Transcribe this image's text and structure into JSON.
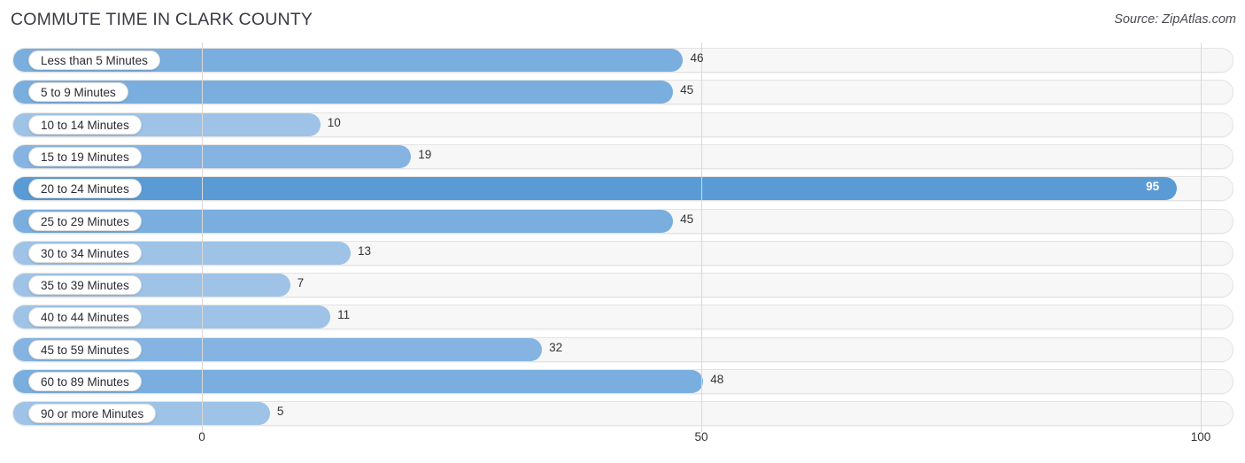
{
  "header": {
    "title": "COMMUTE TIME IN CLARK COUNTY",
    "source": "Source: ZipAtlas.com"
  },
  "colors": {
    "bar_low": "#9ec3e6",
    "bar_mid": "#85b4e2",
    "bar_high": "#7aaedf",
    "bar_max": "#5b9bd5",
    "track": "#f7f7f7",
    "gridline": "#d9d9d9",
    "title_text": "#3a3a44"
  },
  "chart_data": {
    "type": "bar",
    "orientation": "horizontal",
    "title": "COMMUTE TIME IN CLARK COUNTY",
    "subtitle": "",
    "xlabel": "",
    "ylabel": "",
    "xlim": [
      0,
      100
    ],
    "grid": true,
    "legend": null,
    "source": "Source: ZipAtlas.com",
    "xticks": [
      0,
      50,
      100
    ],
    "xtick_labels": [
      "0",
      "50",
      "100"
    ],
    "highlight_category": "20 to 24 Minutes",
    "categories": [
      "Less than 5 Minutes",
      "5 to 9 Minutes",
      "10 to 14 Minutes",
      "15 to 19 Minutes",
      "20 to 24 Minutes",
      "25 to 29 Minutes",
      "30 to 34 Minutes",
      "35 to 39 Minutes",
      "40 to 44 Minutes",
      "45 to 59 Minutes",
      "60 to 89 Minutes",
      "90 or more Minutes"
    ],
    "values": [
      46,
      45,
      10,
      19,
      95,
      45,
      13,
      7,
      11,
      32,
      48,
      5
    ],
    "value_labels": [
      "46",
      "45",
      "10",
      "19",
      "95",
      "45",
      "13",
      "7",
      "11",
      "32",
      "48",
      "5"
    ]
  }
}
